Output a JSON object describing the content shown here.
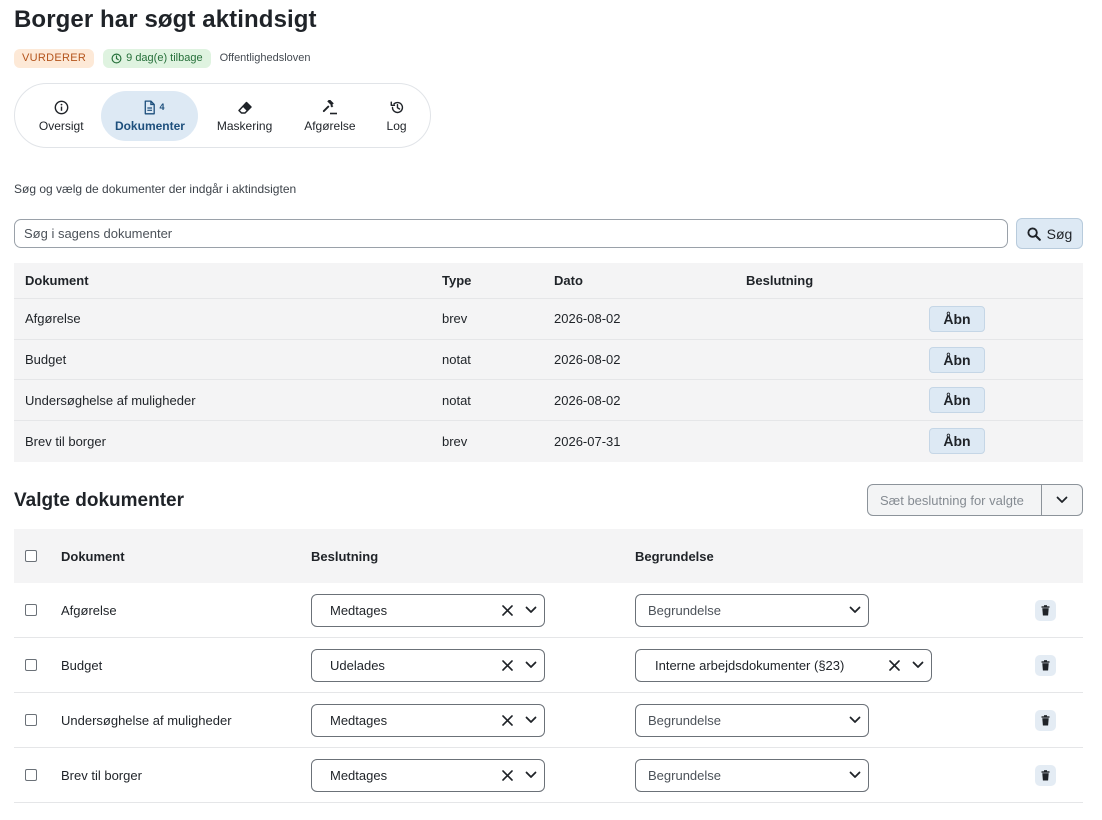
{
  "page": {
    "title": "Borger har søgt aktindsigt",
    "status_badge": "VURDERER",
    "time_badge": "9 dag(e) tilbage",
    "law_badge": "Offentlighedsloven"
  },
  "tabs": [
    {
      "label": "Oversigt",
      "icon": "info-icon"
    },
    {
      "label": "Dokumenter",
      "icon": "document-icon",
      "count": "4",
      "active": true
    },
    {
      "label": "Maskering",
      "icon": "eraser-icon"
    },
    {
      "label": "Afgørelse",
      "icon": "gavel-icon"
    },
    {
      "label": "Log",
      "icon": "history-icon"
    }
  ],
  "search": {
    "hint": "Søg og vælg de dokumenter der indgår i aktindsigten",
    "placeholder": "Søg i sagens dokumenter",
    "button_label": "Søg"
  },
  "documents": {
    "headers": {
      "document": "Dokument",
      "type": "Type",
      "date": "Dato",
      "decision": "Beslutning"
    },
    "open_label": "Åbn",
    "rows": [
      {
        "name": "Afgørelse",
        "type": "brev",
        "date": "2026-08-02"
      },
      {
        "name": "Budget",
        "type": "notat",
        "date": "2026-08-02"
      },
      {
        "name": "Undersøghelse af muligheder",
        "type": "notat",
        "date": "2026-08-02"
      },
      {
        "name": "Brev til borger",
        "type": "brev",
        "date": "2026-07-31"
      }
    ]
  },
  "selected": {
    "title": "Valgte dokumenter",
    "bulk_placeholder": "Sæt beslutning for valgte",
    "headers": {
      "document": "Dokument",
      "decision": "Beslutning",
      "reason": "Begrundelse"
    },
    "reason_placeholder": "Begrundelse",
    "rows": [
      {
        "name": "Afgørelse",
        "decision": "Medtages",
        "reason": ""
      },
      {
        "name": "Budget",
        "decision": "Udelades",
        "reason": "Interne arbejdsdokumenter (§23)"
      },
      {
        "name": "Undersøghelse af muligheder",
        "decision": "Medtages",
        "reason": ""
      },
      {
        "name": "Brev til borger",
        "decision": "Medtages",
        "reason": ""
      }
    ]
  },
  "colors": {
    "accent_bg": "#dde9f4",
    "accent_text": "#1d4f7c",
    "status_bg": "#fde9d7",
    "status_text": "#b4541c",
    "time_bg": "#dff3e0",
    "time_text": "#26703a"
  }
}
